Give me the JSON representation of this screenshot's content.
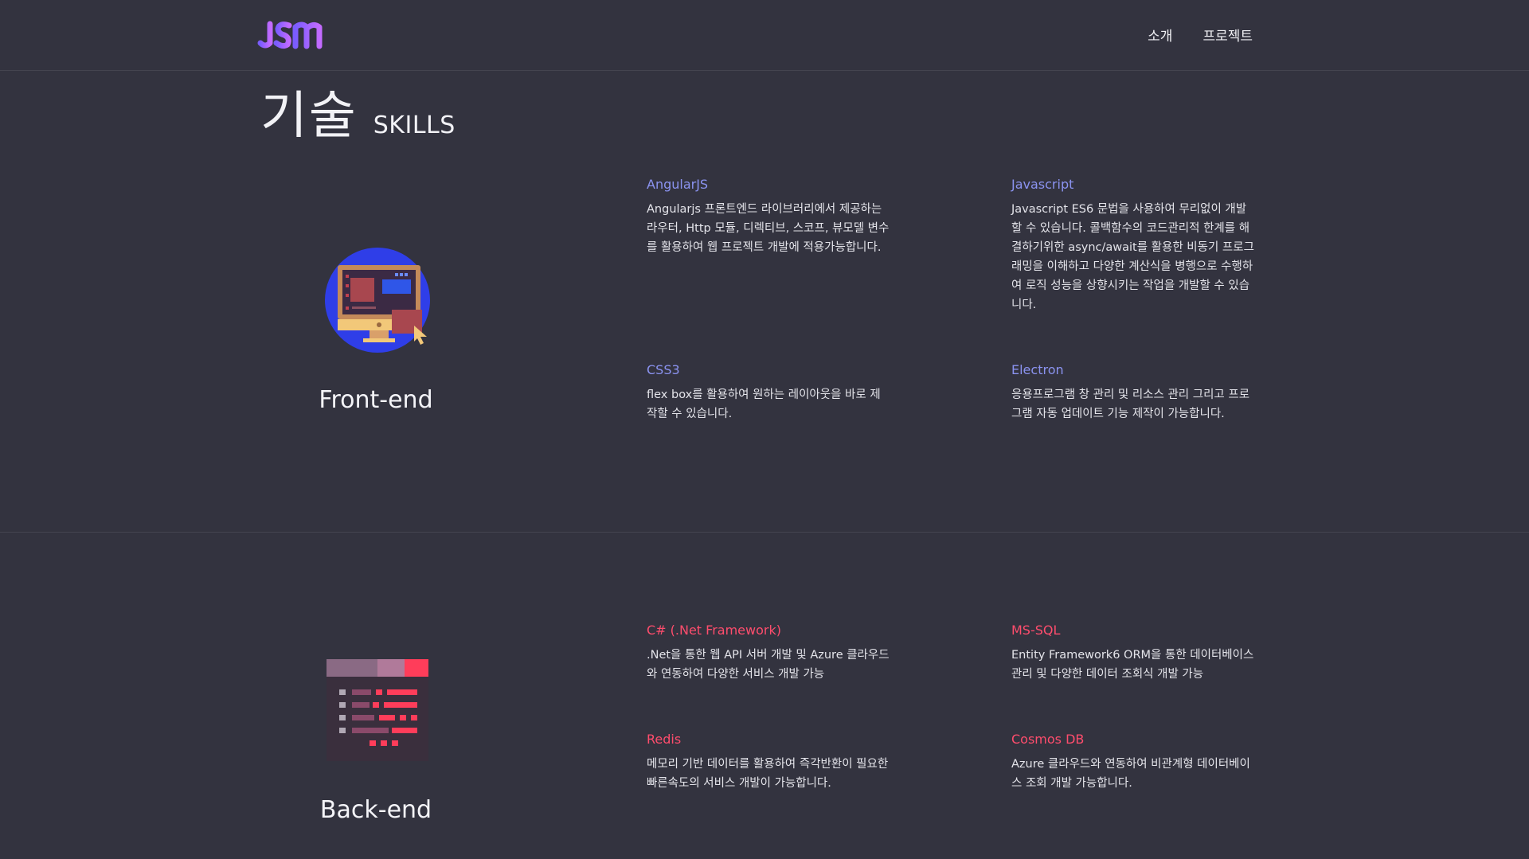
{
  "header": {
    "nav": [
      {
        "label": "소개"
      },
      {
        "label": "프로젝트"
      }
    ]
  },
  "page_title": {
    "ko": "기술",
    "en": "SKILLS"
  },
  "sections": [
    {
      "label": "Front-end",
      "icon": "monitor-cursor-icon",
      "accent": "#8b93f0",
      "skills": [
        {
          "name": "AngularJS",
          "desc": "Angularjs 프론트엔드 라이브러리에서 제공하는 라우터, Http 모듈, 디렉티브, 스코프, 뷰모델 변수를 활용하여 웹 프로젝트 개발에 적용가능합니다."
        },
        {
          "name": "Javascript",
          "desc": "Javascript ES6 문법을 사용하여 무리없이 개발할 수 있습니다. 콜백함수의 코드관리적 한계를 해결하기위한 async/await를 활용한 비동기 프로그래밍을 이해하고 다양한 계산식을 병행으로 수행하여 로직 성능을 상향시키는 작업을 개발할 수 있습니다."
        },
        {
          "name": "CSS3",
          "desc": "flex box를 활용하여 원하는 레이아웃을 바로 제작할 수 있습니다."
        },
        {
          "name": "Electron",
          "desc": "응용프로그램 창 관리 및 리소스 관리 그리고 프로그램 자동 업데이트 기능 제작이 가능합니다."
        }
      ]
    },
    {
      "label": "Back-end",
      "icon": "code-window-icon",
      "accent": "#ff4d6d",
      "skills": [
        {
          "name": "C# (.Net Framework)",
          "desc": ".Net을 통한 웹 API 서버 개발 및 Azure 클라우드와 연동하여 다양한 서비스 개발 가능"
        },
        {
          "name": "MS-SQL",
          "desc": "Entity Framework6 ORM을 통한 데이터베이스 관리 및 다양한 데이터 조회식 개발 가능"
        },
        {
          "name": "Redis",
          "desc": "메모리 기반 데이터를 활용하여 즉각반환이 필요한 빠른속도의 서비스 개발이 가능합니다."
        },
        {
          "name": "Cosmos DB",
          "desc": "Azure 클라우드와 연동하여 비관계형 데이터베이스 조회 개발 가능합니다."
        }
      ]
    }
  ]
}
